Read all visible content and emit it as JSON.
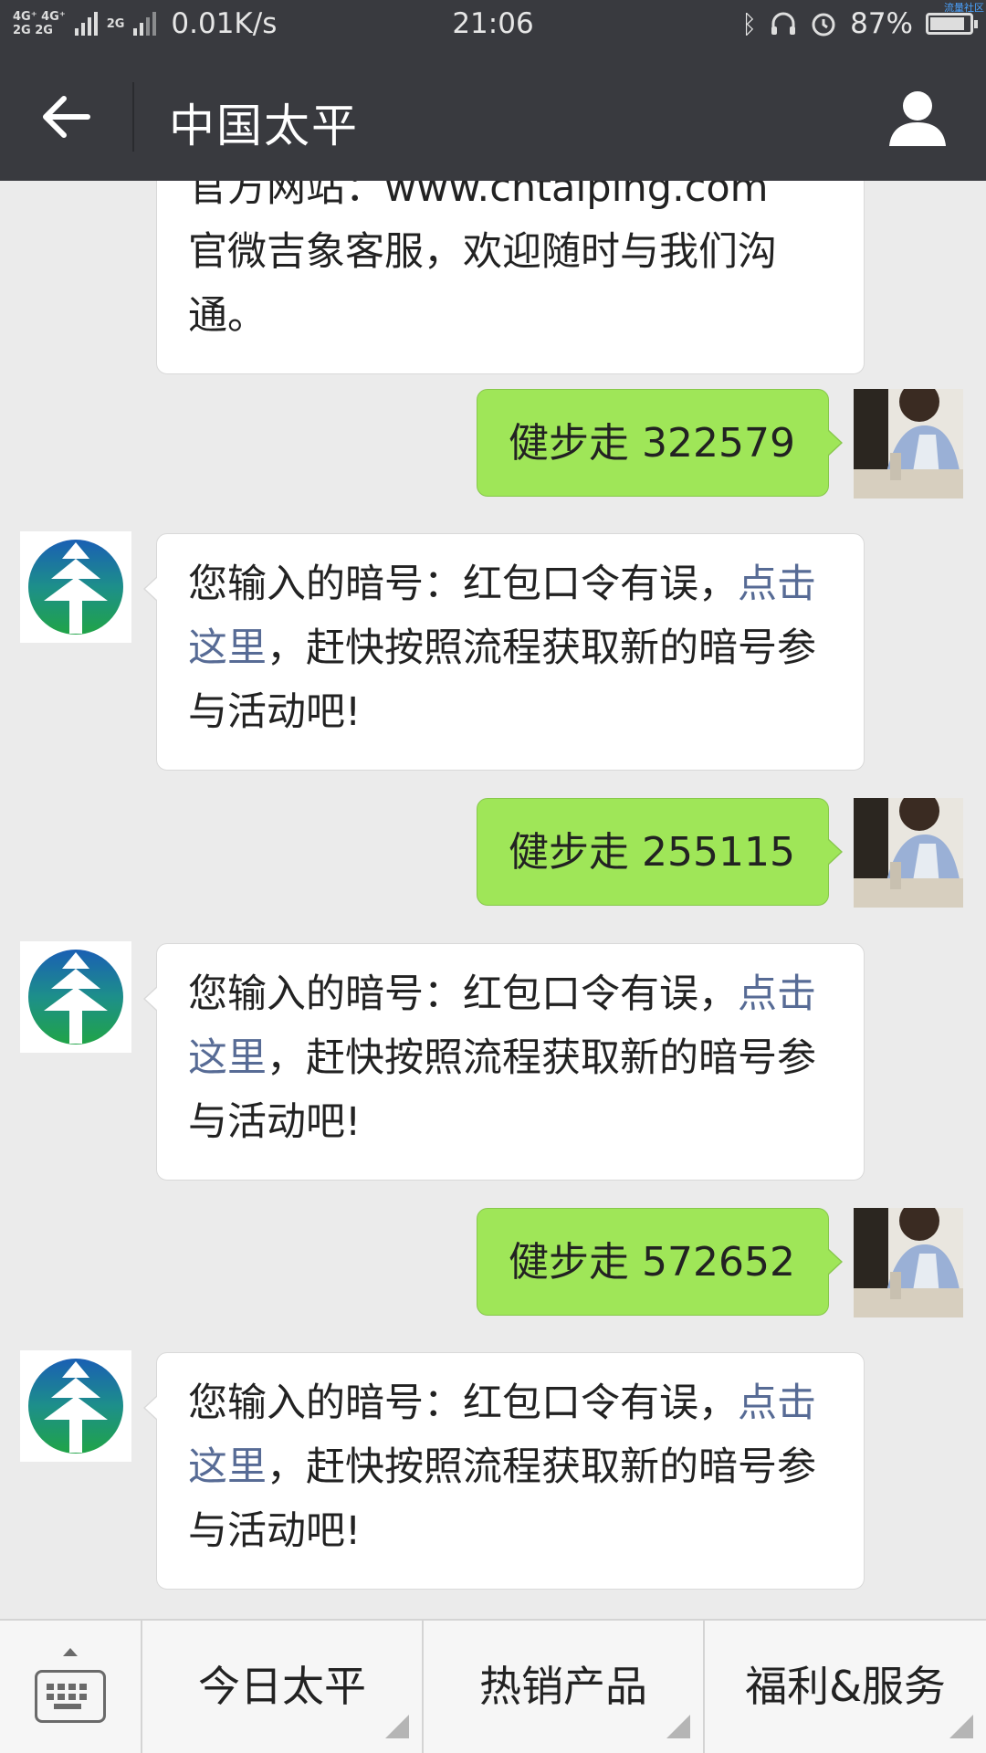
{
  "status_bar": {
    "network_top": "4G⁺ 4G⁺",
    "network_bottom": "2G 2G",
    "signal_extra": "2G",
    "speed": "0.01K/s",
    "time": "21:06",
    "battery": "87%",
    "battery_level": 0.87,
    "watermark": "流量社区"
  },
  "header": {
    "title": "中国太平"
  },
  "messages": {
    "m0": {
      "line_partial": "官方网站：www.cntaiping.com",
      "text": "官微吉象客服，欢迎随时与我们沟通。"
    },
    "m1": {
      "text": "健步走 322579"
    },
    "m2": {
      "text_before": "您输入的暗号：红包口令有误，",
      "link": "点击这里",
      "text_after": "，赶快按照流程获取新的暗号参与活动吧!"
    },
    "m3": {
      "text": "健步走 255115"
    },
    "m4": {
      "text_before": "您输入的暗号：红包口令有误，",
      "link": "点击这里",
      "text_after": "，赶快按照流程获取新的暗号参与活动吧!"
    },
    "m5": {
      "text": "健步走 572652"
    },
    "m6": {
      "text_before": "您输入的暗号：红包口令有误，",
      "link": "点击这里",
      "text_after": "，赶快按照流程获取新的暗号参与活动吧!"
    }
  },
  "bottom_menu": {
    "item1": "今日太平",
    "item2": "热销产品",
    "item3": "福利&服务"
  },
  "icons": {
    "back": "back-arrow-icon",
    "profile": "person-icon",
    "keyboard": "keyboard-icon",
    "bluetooth": "bluetooth-icon",
    "headset": "headset-icon",
    "alarm": "alarm-icon"
  },
  "colors": {
    "header_bg": "#393a3f",
    "sent_bubble": "#9fe658",
    "link": "#576b95",
    "chat_bg": "#ebebeb"
  }
}
